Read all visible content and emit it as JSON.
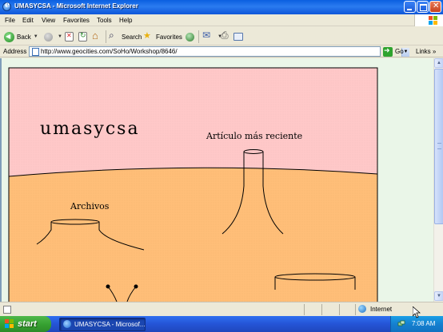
{
  "window": {
    "title": "UMASYCSA - Microsoft Internet Explorer"
  },
  "menu": [
    "File",
    "Edit",
    "View",
    "Favorites",
    "Tools",
    "Help"
  ],
  "toolbar": {
    "back_label": "Back",
    "search_label": "Search",
    "favorites_label": "Favorites"
  },
  "address": {
    "label": "Address",
    "url": "http://www.geocities.com/SoHo/Workshop/8646/",
    "go_label": "Go",
    "links_label": "Links"
  },
  "page": {
    "site_title": "umasycsa",
    "recent_article_label": "Artículo más reciente",
    "archives_label": "Archivos",
    "colors": {
      "sky": "#FFC8C8",
      "ground": "#FFBE78",
      "frame_bg": "#EAF6E8"
    }
  },
  "status": {
    "zone_label": "Internet"
  },
  "taskbar": {
    "start_label": "start",
    "task_label": "UMASYCSA - Microsof...",
    "clock": "7:08 AM"
  }
}
